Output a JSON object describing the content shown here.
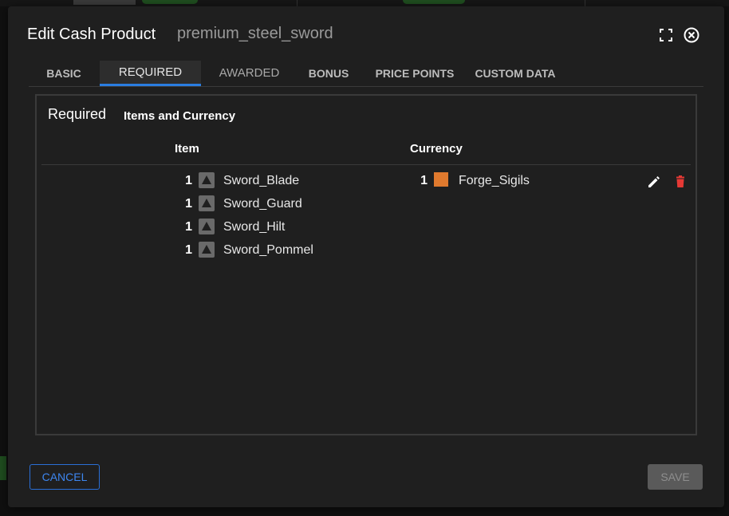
{
  "modal": {
    "title": "Edit Cash Product",
    "product_id": "premium_steel_sword"
  },
  "tabs": [
    {
      "label": "BASIC"
    },
    {
      "label": "REQUIRED",
      "active": true
    },
    {
      "label": "AWARDED"
    },
    {
      "label": "BONUS"
    },
    {
      "label": "PRICE POINTS"
    },
    {
      "label": "CUSTOM DATA"
    }
  ],
  "panel": {
    "heading": "Required",
    "subheading": "Items and Currency",
    "columns": {
      "item": "Item",
      "currency": "Currency"
    },
    "items": [
      {
        "qty": "1",
        "name": "Sword_Blade",
        "icon": "triangle-up-icon"
      },
      {
        "qty": "1",
        "name": "Sword_Guard",
        "icon": "triangle-up-icon"
      },
      {
        "qty": "1",
        "name": "Sword_Hilt",
        "icon": "triangle-up-icon"
      },
      {
        "qty": "1",
        "name": "Sword_Pommel",
        "icon": "triangle-up-icon"
      }
    ],
    "currencies": [
      {
        "qty": "1",
        "name": "Forge_Sigils",
        "color": "#e07a2e"
      }
    ],
    "actions": {
      "edit_icon": "pencil-icon",
      "delete_icon": "trash-icon",
      "delete_color": "#e53935"
    }
  },
  "footer": {
    "cancel_label": "CANCEL",
    "save_label": "SAVE"
  },
  "colors": {
    "accent": "#2a7de1",
    "cancel_text": "#3d86f0",
    "save_disabled_bg": "#5a5a5a"
  }
}
